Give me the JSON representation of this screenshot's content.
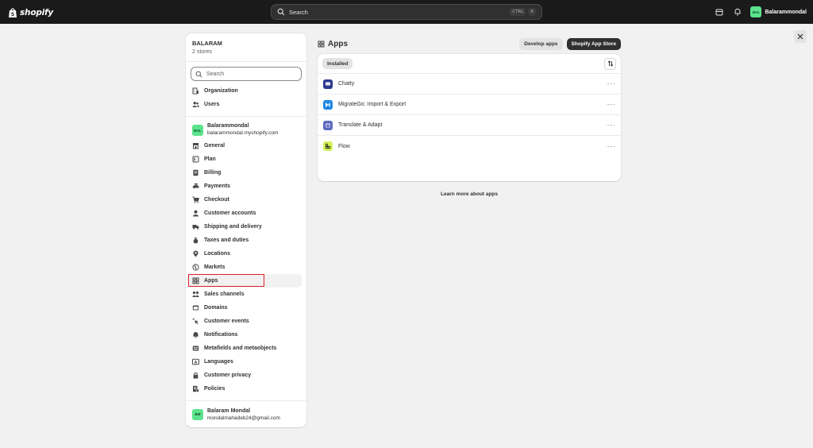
{
  "topbar": {
    "brand": "shopify",
    "search_placeholder": "Search",
    "shortcut_ctrl": "CTRL",
    "shortcut_key": "K",
    "store_initials": "BAL",
    "store_name": "Balarammondal"
  },
  "sidebar": {
    "org_name": "BALARAM",
    "org_sub": "2 stores",
    "search_placeholder": "Search",
    "org_items": [
      {
        "label": "Organization",
        "icon": "building-icon"
      },
      {
        "label": "Users",
        "icon": "users-icon"
      }
    ],
    "store": {
      "initials": "BAL",
      "name": "Balarammondal",
      "domain": "balarammondal.myshopify.com"
    },
    "items": [
      {
        "label": "General",
        "icon": "store-icon"
      },
      {
        "label": "Plan",
        "icon": "plan-icon"
      },
      {
        "label": "Billing",
        "icon": "receipt-icon"
      },
      {
        "label": "Payments",
        "icon": "payments-icon"
      },
      {
        "label": "Checkout",
        "icon": "cart-icon"
      },
      {
        "label": "Customer accounts",
        "icon": "person-icon"
      },
      {
        "label": "Shipping and delivery",
        "icon": "truck-icon"
      },
      {
        "label": "Taxes and duties",
        "icon": "money-bag-icon"
      },
      {
        "label": "Locations",
        "icon": "location-pin-icon"
      },
      {
        "label": "Markets",
        "icon": "globe-icon"
      },
      {
        "label": "Apps",
        "icon": "apps-grid-icon"
      },
      {
        "label": "Sales channels",
        "icon": "channels-icon"
      },
      {
        "label": "Domains",
        "icon": "domain-icon"
      },
      {
        "label": "Customer events",
        "icon": "cursor-click-icon"
      },
      {
        "label": "Notifications",
        "icon": "bell-icon"
      },
      {
        "label": "Metafields and metaobjects",
        "icon": "metafields-icon"
      },
      {
        "label": "Languages",
        "icon": "language-icon"
      },
      {
        "label": "Customer privacy",
        "icon": "lock-icon"
      },
      {
        "label": "Policies",
        "icon": "policy-icon"
      }
    ],
    "active": "Apps",
    "user": {
      "initials": "BM",
      "name": "Balaram Mondal",
      "email": "mondalmahadeb24@gmail.com"
    }
  },
  "main": {
    "title": "Apps",
    "develop_label": "Develop apps",
    "store_label": "Shopify App Store",
    "filter_label": "Installed",
    "apps": [
      {
        "name": "Chatty",
        "icon": "chatty-icon",
        "color": "#2b3a8f"
      },
      {
        "name": "MigrateGo: Import & Export",
        "icon": "migratego-icon",
        "color": "#1e88e5"
      },
      {
        "name": "Translate & Adapt",
        "icon": "translate-icon",
        "color": "#5c6bc0"
      },
      {
        "name": "Flow",
        "icon": "flow-icon",
        "color": "#d4f25a"
      }
    ],
    "learn_more": "Learn more about apps"
  },
  "colors": {
    "topbar_bg": "#1a1a1a",
    "accent_green": "#5be38d",
    "highlight_red": "#e01e2c"
  }
}
